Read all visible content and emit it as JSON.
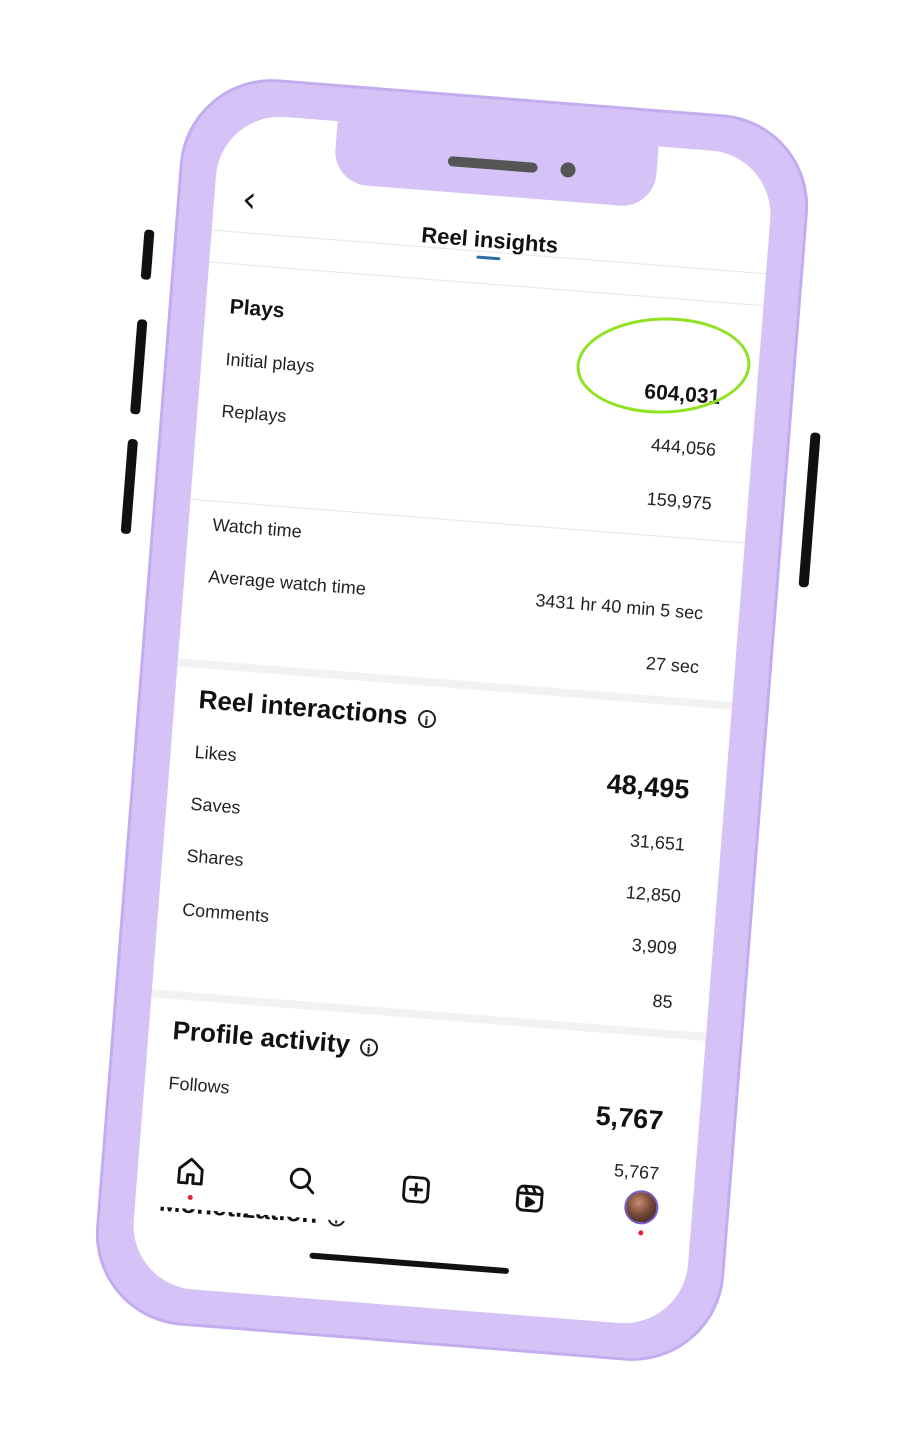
{
  "header": {
    "title": "Reel insights"
  },
  "plays": {
    "section_title": "Plays",
    "value": "604,031",
    "rows": [
      {
        "label": "Initial plays",
        "value": "444,056"
      },
      {
        "label": "Replays",
        "value": "159,975"
      }
    ]
  },
  "watch": {
    "rows": [
      {
        "label": "Watch time",
        "value": "3431 hr 40 min 5 sec"
      },
      {
        "label": "Average watch time",
        "value": "27 sec"
      }
    ]
  },
  "interactions": {
    "section_title": "Reel interactions",
    "total": "48,495",
    "rows": [
      {
        "label": "Likes",
        "value": "31,651"
      },
      {
        "label": "Saves",
        "value": "12,850"
      },
      {
        "label": "Shares",
        "value": "3,909"
      },
      {
        "label": "Comments",
        "value": "85"
      }
    ]
  },
  "profile_activity": {
    "section_title": "Profile activity",
    "total": "5,767",
    "rows": [
      {
        "label": "Follows",
        "value": "5,767"
      }
    ]
  },
  "monetization": {
    "section_title": "Monetization"
  },
  "nav": {
    "items": [
      "home-icon",
      "search-icon",
      "create-icon",
      "reels-icon",
      "profile-avatar"
    ]
  },
  "colors": {
    "frame": "#d5c3f7",
    "highlight": "#8fe21f",
    "notification_dot": "#e6203a"
  }
}
